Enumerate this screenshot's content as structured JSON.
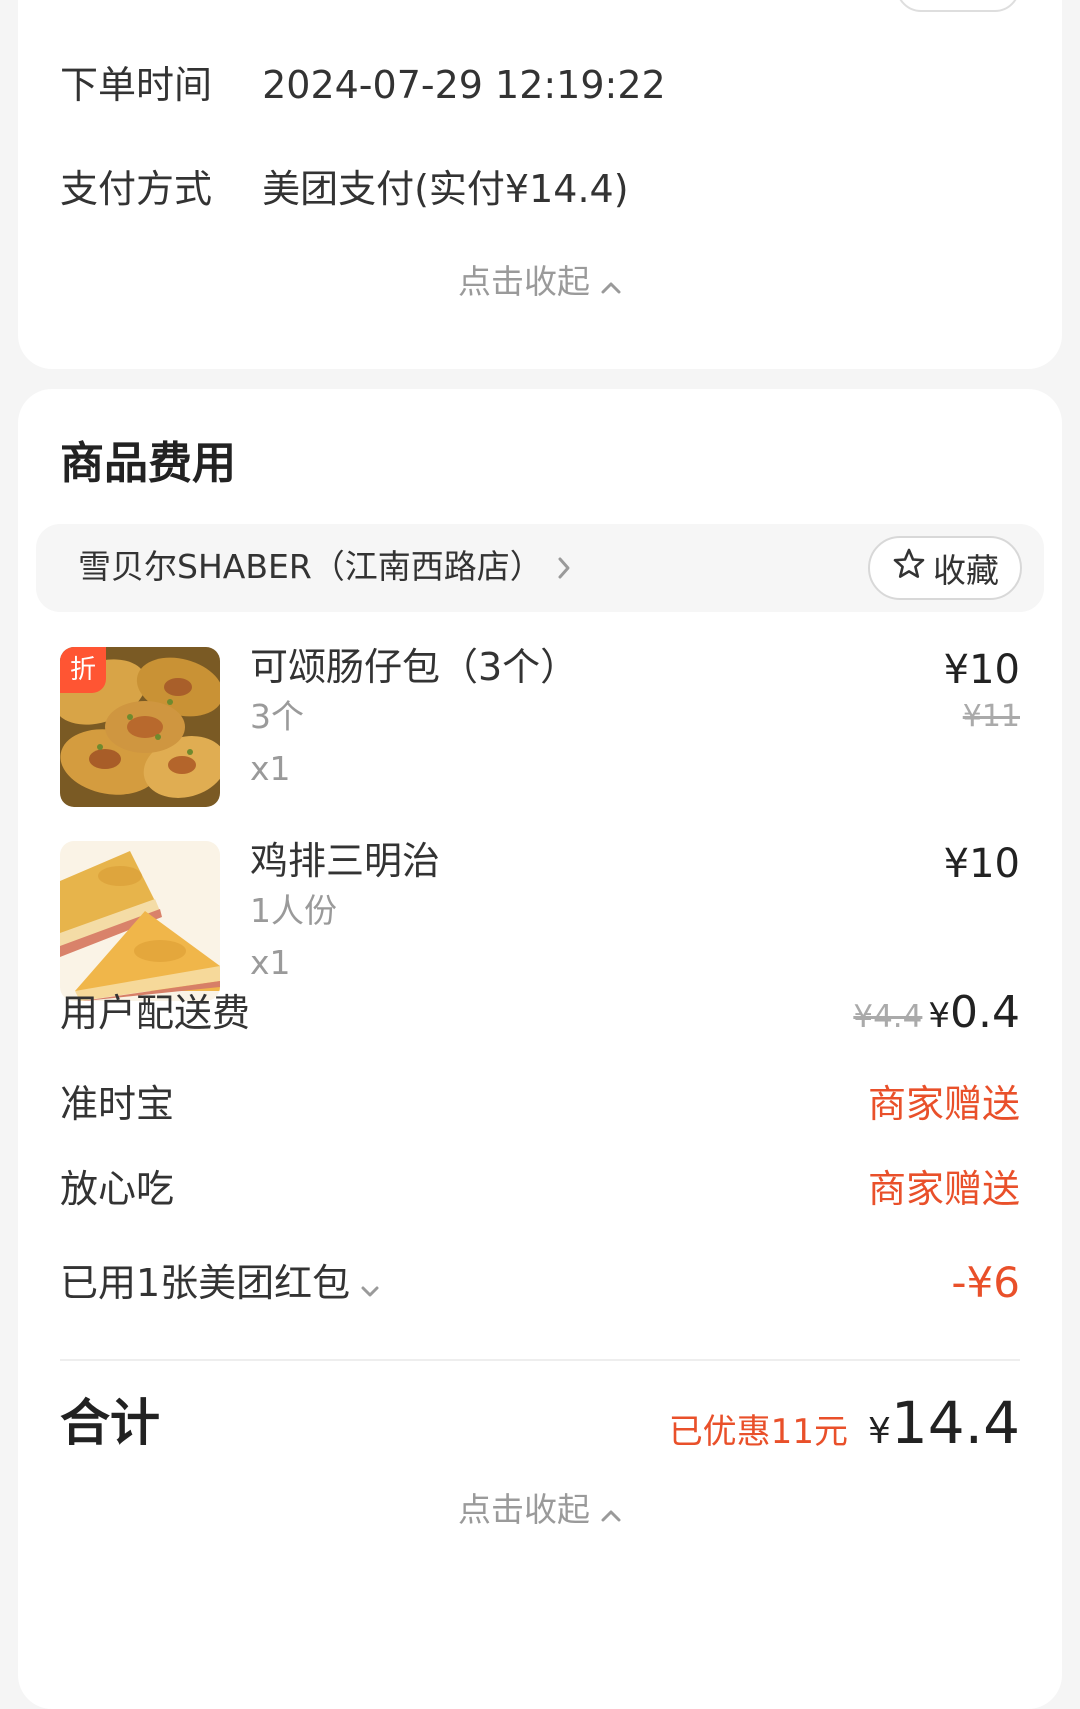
{
  "order_info": {
    "order_time_label": "下单时间",
    "order_time_value": "2024-07-29 12:19:22",
    "payment_label": "支付方式",
    "payment_value": "美团支付(实付¥14.4)",
    "collapse_label": "点击收起"
  },
  "goods": {
    "section_title": "商品费用",
    "shop_name": "雪贝尔SHABER（江南西路店）",
    "favorite_label": "收藏",
    "discount_badge": "折",
    "items": [
      {
        "name": "可颂肠仔包（3个）",
        "spec": "3个",
        "qty": "x1",
        "price": "¥10",
        "original_price": "¥11",
        "thumb_icon": "croissant-sausage-bun-image"
      },
      {
        "name": "鸡排三明治",
        "spec": "1人份",
        "qty": "x1",
        "price": "¥10",
        "thumb_icon": "chicken-sandwich-image"
      }
    ],
    "fees": {
      "delivery_label": "用户配送费",
      "delivery_original": "¥4.4",
      "delivery_yen": "¥",
      "delivery_value": "0.4",
      "ontime_label": "准时宝",
      "ontime_value": "商家赠送",
      "safe_eat_label": "放心吃",
      "safe_eat_value": "商家赠送",
      "coupon_label": "已用1张美团红包",
      "coupon_value": "-¥6"
    },
    "total": {
      "label": "合计",
      "saved": "已优惠11元",
      "yen": "¥",
      "amount": "14.4"
    },
    "collapse_label": "点击收起"
  },
  "colors": {
    "accent_red": "#e9502a",
    "badge_orange": "#ff5533",
    "muted_gray": "#9a9a9a"
  }
}
